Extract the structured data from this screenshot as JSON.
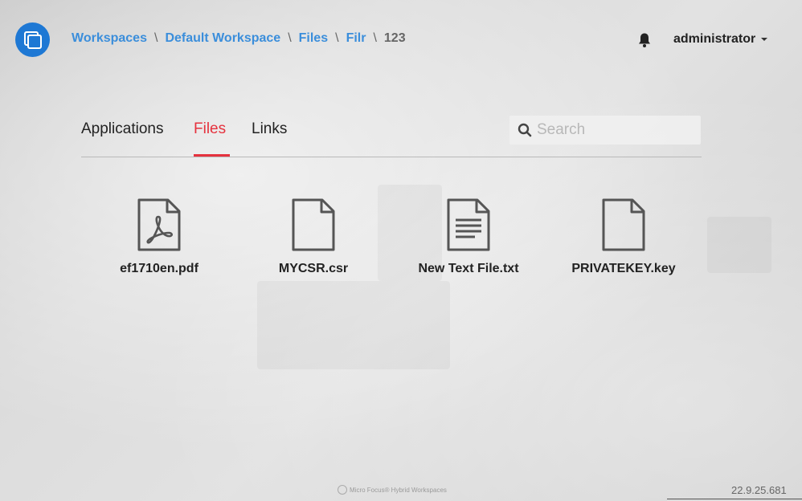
{
  "header": {
    "logo_icon": "app-logo-icon",
    "breadcrumb": {
      "items": [
        "Workspaces",
        "Default Workspace",
        "Files",
        "Filr"
      ],
      "current": "123",
      "separator": "\\"
    },
    "notifications_icon": "bell-icon",
    "user": "administrator"
  },
  "tabs": [
    {
      "label": "Applications",
      "active": false
    },
    {
      "label": "Files",
      "active": true
    },
    {
      "label": "Links",
      "active": false
    }
  ],
  "search": {
    "placeholder": "Search",
    "value": ""
  },
  "files": [
    {
      "name": "ef1710en.pdf",
      "icon": "pdf-file-icon"
    },
    {
      "name": "MYCSR.csr",
      "icon": "blank-file-icon"
    },
    {
      "name": "New Text File.txt",
      "icon": "text-file-icon"
    },
    {
      "name": "PRIVATEKEY.key",
      "icon": "blank-file-icon"
    }
  ],
  "footer": {
    "brand": "Micro Focus® Hybrid Workspaces",
    "version": "22.9.25.681"
  },
  "colors": {
    "accent_blue": "#1e78d4",
    "link_blue": "#3b8edb",
    "active_tab_red": "#e5323e"
  }
}
